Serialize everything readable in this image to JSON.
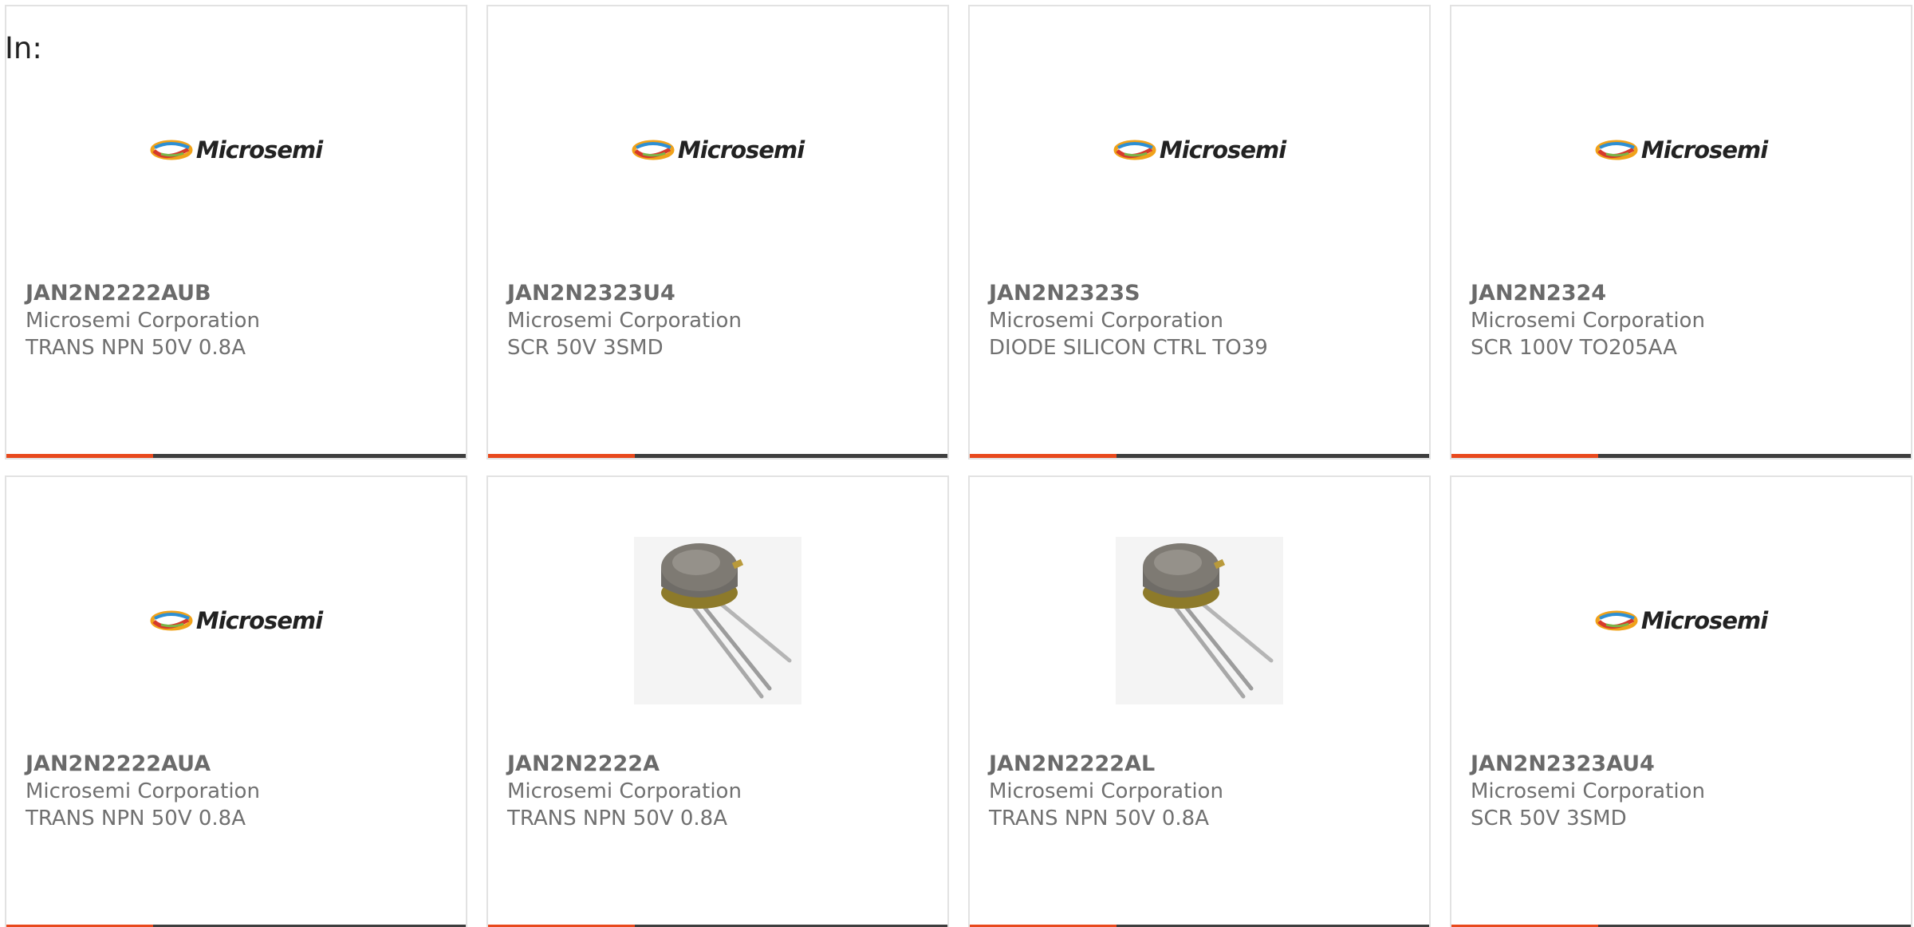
{
  "header": {
    "label": "In:"
  },
  "colors": {
    "accent": "#e8491d",
    "bar_dark": "#3e3e3e"
  },
  "products": [
    {
      "part": "JAN2N2222AUB",
      "maker": "Microsemi Corporation",
      "desc": "TRANS NPN 50V 0.8A",
      "image": "microsemi-logo"
    },
    {
      "part": "JAN2N2323U4",
      "maker": "Microsemi Corporation",
      "desc": "SCR 50V 3SMD",
      "image": "microsemi-logo"
    },
    {
      "part": "JAN2N2323S",
      "maker": "Microsemi Corporation",
      "desc": "DIODE SILICON CTRL TO39",
      "image": "microsemi-logo"
    },
    {
      "part": "JAN2N2324",
      "maker": "Microsemi Corporation",
      "desc": "SCR 100V TO205AA",
      "image": "microsemi-logo"
    },
    {
      "part": "JAN2N2222AUA",
      "maker": "Microsemi Corporation",
      "desc": "TRANS NPN 50V 0.8A",
      "image": "microsemi-logo"
    },
    {
      "part": "JAN2N2222A",
      "maker": "Microsemi Corporation",
      "desc": "TRANS NPN 50V 0.8A",
      "image": "transistor-to18-photo"
    },
    {
      "part": "JAN2N2222AL",
      "maker": "Microsemi Corporation",
      "desc": "TRANS NPN 50V 0.8A",
      "image": "transistor-to18-photo"
    },
    {
      "part": "JAN2N2323AU4",
      "maker": "Microsemi Corporation",
      "desc": "SCR 50V 3SMD",
      "image": "microsemi-logo"
    }
  ],
  "logo": {
    "text": "Microsemi"
  }
}
